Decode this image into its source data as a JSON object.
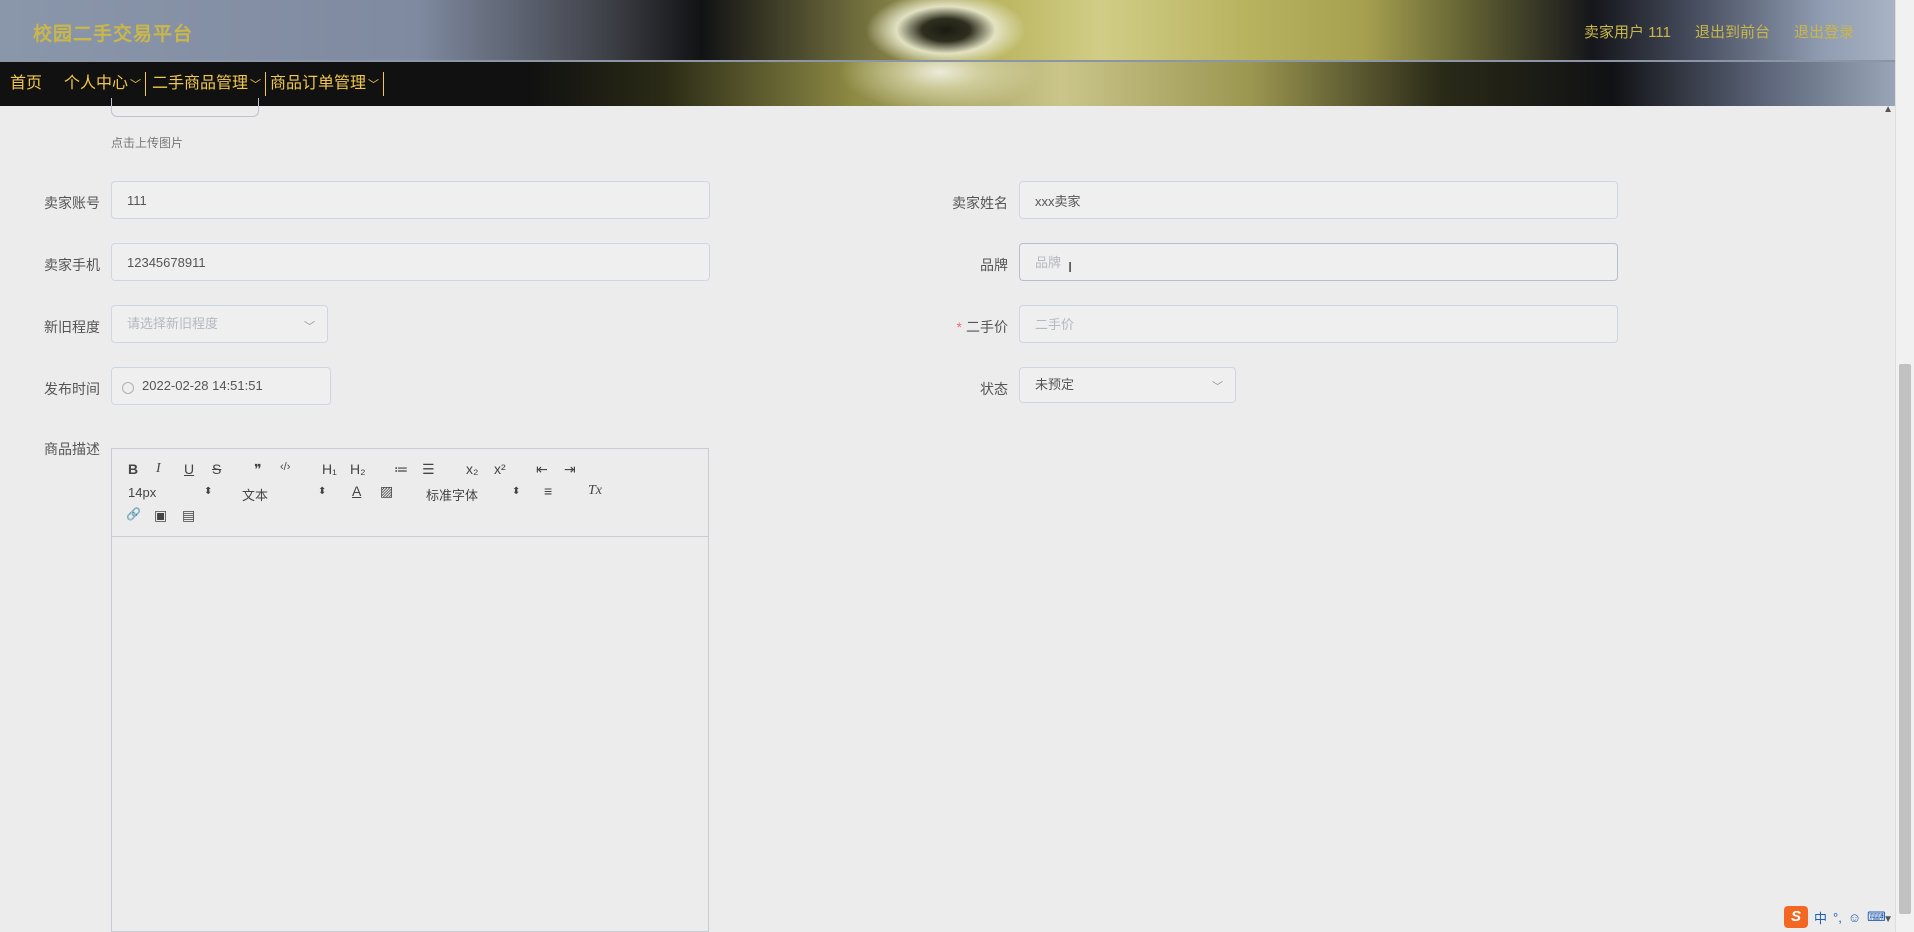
{
  "header": {
    "logo": "校园二手交易平台",
    "user_label": "卖家用户 111",
    "frontend_link": "退出到前台",
    "logout_link": "退出登录"
  },
  "nav": {
    "home": "首页",
    "personal": "个人中心",
    "goods": "二手商品管理",
    "orders": "商品订单管理"
  },
  "form": {
    "upload_hint": "点击上传图片",
    "seller_account": {
      "label": "卖家账号",
      "value": "111"
    },
    "seller_name": {
      "label": "卖家姓名",
      "value": "xxx卖家"
    },
    "seller_phone": {
      "label": "卖家手机",
      "value": "12345678911"
    },
    "brand": {
      "label": "品牌",
      "value": "",
      "placeholder": "品牌"
    },
    "condition": {
      "label": "新旧程度",
      "placeholder": "请选择新旧程度"
    },
    "price": {
      "label": "二手价",
      "required": "*",
      "value": "",
      "placeholder": "二手价"
    },
    "publish_time": {
      "label": "发布时间",
      "value": "2022-02-28 14:51:51"
    },
    "status": {
      "label": "状态",
      "value": "未预定"
    },
    "description": {
      "label": "商品描述"
    }
  },
  "editor_toolbar": {
    "bold": "B",
    "italic": "I",
    "underline": "U",
    "strike": "S",
    "quote": "❞",
    "code": "‹/›",
    "h1": "H₁",
    "h2": "H₂",
    "ordered": "≔",
    "bullet": "☰",
    "sub": "x₂",
    "sup": "x²",
    "outdent": "⇤",
    "indent": "⇥",
    "size": "14px",
    "format": "文本",
    "color": "A",
    "background": "▨",
    "font": "标准字体",
    "align": "≡",
    "clean": "Tx",
    "link": "🔗",
    "image": "▣",
    "video": "▤"
  },
  "ime": {
    "lang": "中",
    "punct": "°,",
    "emoji": "☺",
    "keyboard": "⌨"
  },
  "colors": {
    "accent_gold": "#f1c84a",
    "logo_gold": "#c9b74a",
    "required": "#f56c6c"
  }
}
